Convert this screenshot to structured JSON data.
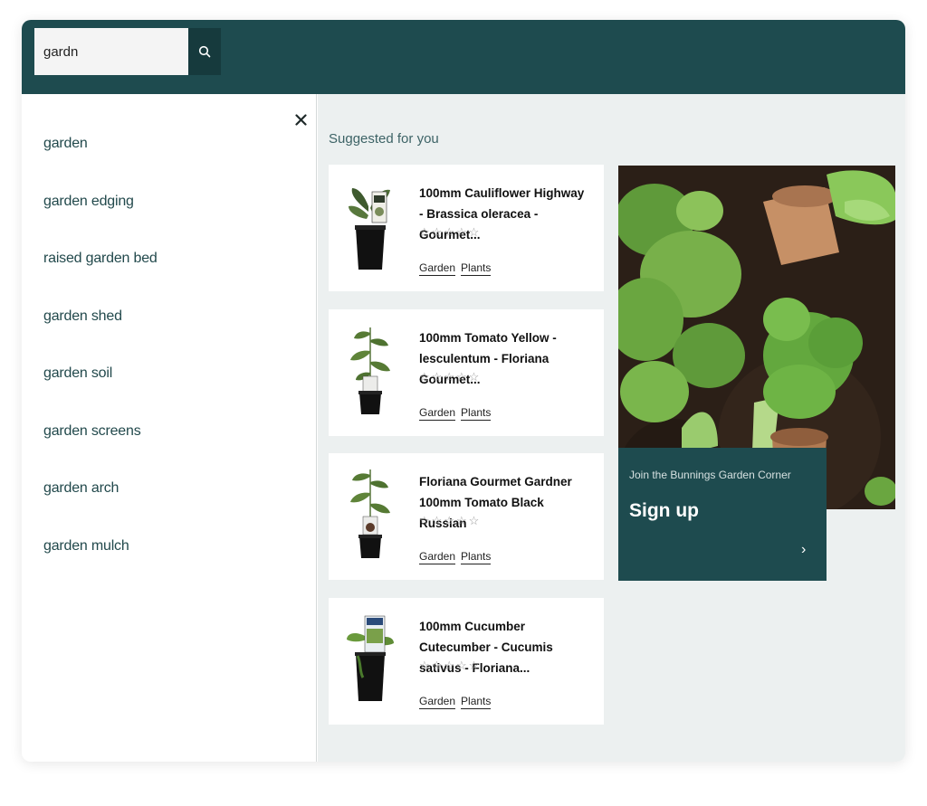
{
  "search": {
    "value": "gardn",
    "icon": "search-icon"
  },
  "close": {
    "icon": "close-icon"
  },
  "suggestions": [
    {
      "label": "garden"
    },
    {
      "label": "garden edging"
    },
    {
      "label": "raised garden bed"
    },
    {
      "label": "garden shed"
    },
    {
      "label": "garden soil"
    },
    {
      "label": "garden screens"
    },
    {
      "label": "garden arch"
    },
    {
      "label": "garden mulch"
    }
  ],
  "suggested": {
    "title": "Suggested for you",
    "products": [
      {
        "name": "100mm Cauliflower Highway - Brassica oleracea - Gourmet...",
        "rating": 0,
        "tags": [
          "Garden",
          "Plants"
        ]
      },
      {
        "name": "100mm Tomato Yellow - lesculentum - Floriana Gourmet...",
        "rating": 0,
        "tags": [
          "Garden",
          "Plants"
        ]
      },
      {
        "name": "Floriana Gourmet Gardner 100mm Tomato Black Russian",
        "rating": 0,
        "tags": [
          "Garden",
          "Plants"
        ]
      },
      {
        "name": "100mm Cucumber Cutecumber - Cucumis sativus - Floriana...",
        "rating": 0,
        "tags": [
          "Garden",
          "Plants"
        ]
      }
    ]
  },
  "promo": {
    "caption": "Join the Bunnings Garden Corner",
    "cta": "Sign up",
    "arrow": "›"
  },
  "colors": {
    "brand": "#1e4b4f",
    "panel_bg": "#ecf0f0"
  }
}
